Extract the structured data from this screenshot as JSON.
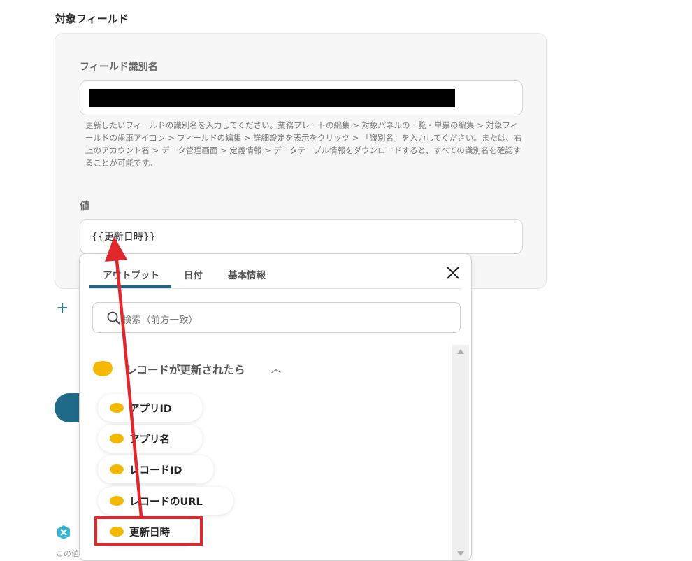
{
  "section": {
    "title": "対象フィールド"
  },
  "field_id": {
    "label": "フィールド識別名",
    "help": "更新したいフィールドの識別名を入力してください。業務プレートの編集 > 対象パネルの一覧・単票の編集 > 対象フィールドの歯車アイコン > フィールドの編集 > 詳細設定を表示をクリック > 「識別名」を入力してください。または、右上のアカウント名 > データ管理画面 > 定義情報 > データテーブル情報をダウンロードすると、すべての識別名を確認することが可能です。"
  },
  "value_field": {
    "label": "値",
    "value": "{{更新日時}}"
  },
  "popover": {
    "tabs": [
      "アウトプット",
      "日付",
      "基本情報"
    ],
    "active_tab": "アウトプット",
    "search_placeholder": "検索（前方一致）",
    "group_label": "レコードが更新されたら",
    "group_icon": "kintone-icon",
    "chip_icon_text": "kintone",
    "items": [
      {
        "label": "アプリID"
      },
      {
        "label": "アプリ名"
      },
      {
        "label": "レコードID"
      },
      {
        "label": "レコードのURL"
      },
      {
        "label": "更新日時"
      }
    ]
  },
  "bottom_hint": "この値",
  "colors": {
    "accent": "#1f6a86",
    "annotation": "#e0282c",
    "kintone": "#f5b800"
  }
}
